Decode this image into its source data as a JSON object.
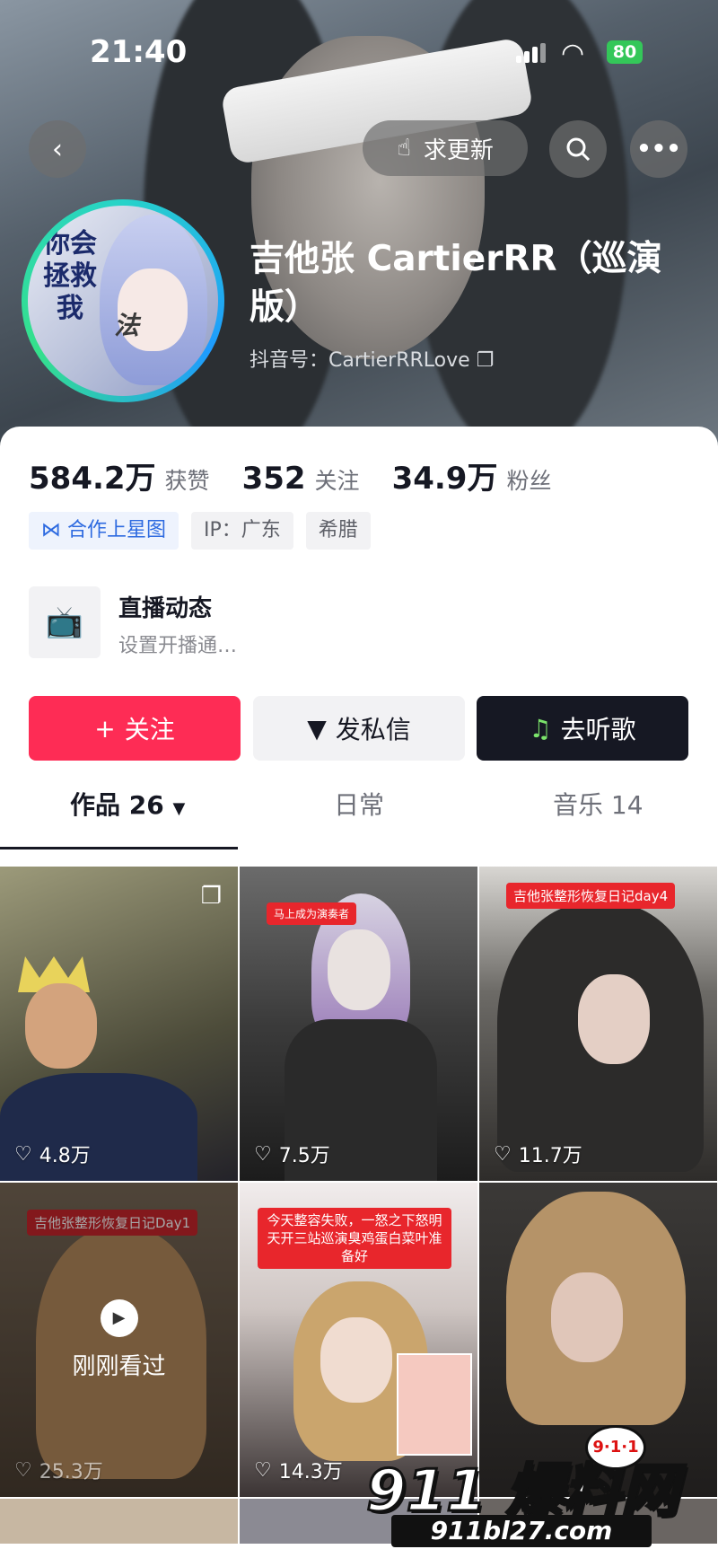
{
  "status_bar": {
    "time": "21:40",
    "battery": "80"
  },
  "header": {
    "update_label": "求更新"
  },
  "profile": {
    "name": "吉他张 CartierRR（巡演版）",
    "douyin_id": "抖音号：CartierRRLove",
    "avatar_text_left": "你会拯救我",
    "avatar_text_right": "法"
  },
  "stats": {
    "likes_num": "584.2万",
    "likes_label": "获赞",
    "following_num": "352",
    "following_label": "关注",
    "fans_num": "34.9万",
    "fans_label": "粉丝"
  },
  "tags": [
    "合作上星图",
    "IP：广东",
    "希腊"
  ],
  "live": {
    "title": "直播动态",
    "subtitle": "设置开播通…"
  },
  "buttons": {
    "follow": "关注",
    "message": "发私信",
    "music": "去听歌"
  },
  "tabs": [
    "作品 26",
    "日常",
    "音乐 14"
  ],
  "grid": [
    {
      "likes": "4.8万"
    },
    {
      "likes": "7.5万",
      "banner": "马上成为演奏者"
    },
    {
      "likes": "11.7万",
      "banner": "吉他张整形恢复日记day4"
    },
    {
      "likes": "25.3万",
      "banner": "吉他张整形恢复日记Day1",
      "overlay": "刚刚看过"
    },
    {
      "likes": "14.3万",
      "banner": "今天整容失败，一怒之下怒明天开三站巡演臭鸡蛋白菜叶准备好"
    },
    {
      "likes": ""
    }
  ],
  "watermark": {
    "main": "911 爆料网",
    "url": "911bl27.com",
    "badge": "9·1·1"
  }
}
